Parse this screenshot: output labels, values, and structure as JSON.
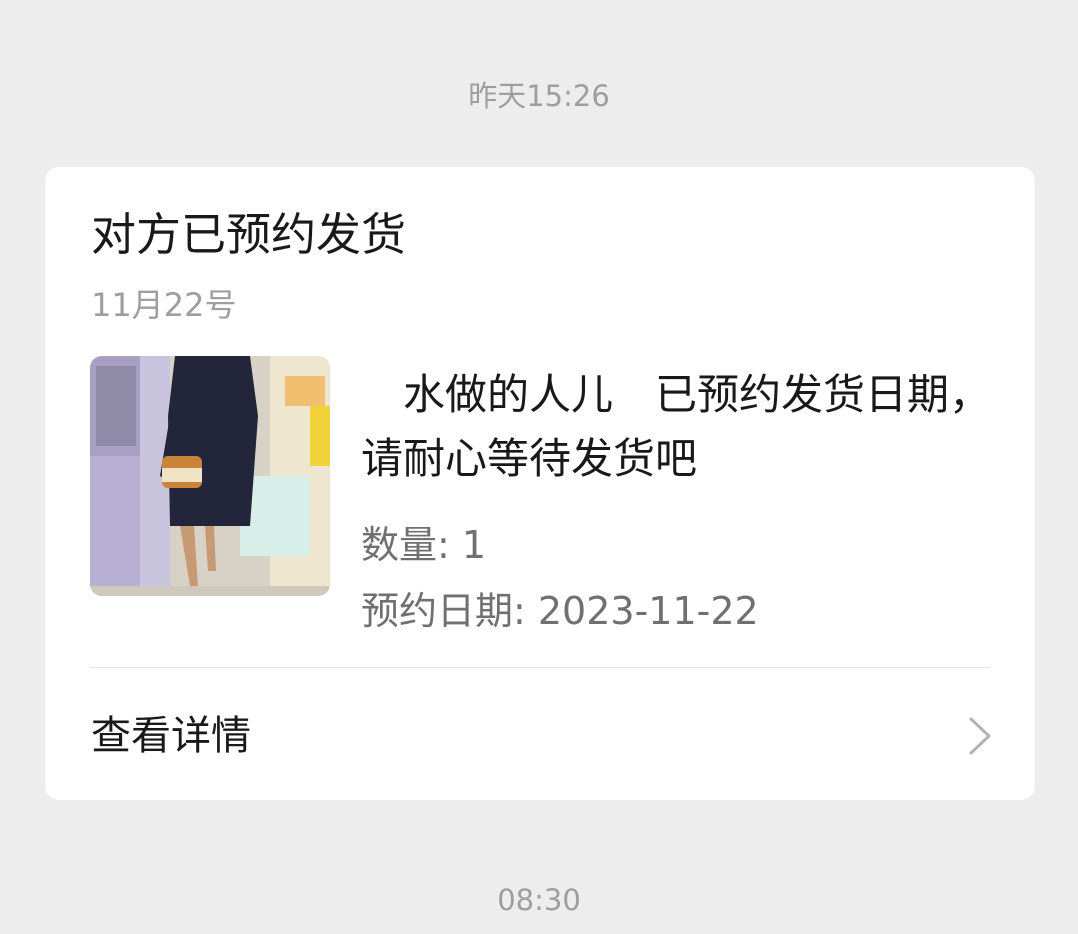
{
  "timestamps": {
    "top": "昨天15:26",
    "bottom": "08:30"
  },
  "card": {
    "title": "对方已预约发货",
    "date": "11月22号",
    "product": {
      "image_alt": "product-photo",
      "description": "　水做的人儿　已预约发货日期，请耐心等待发货吧"
    },
    "quantity_label": "数量: 1",
    "reserve_date_label": "预约日期: 2023-11-22",
    "details_link": "查看详情",
    "details_icon": "chevron-right-icon"
  },
  "colors": {
    "background": "#ededed",
    "card": "#ffffff",
    "primary_text": "#191919",
    "secondary_text": "#9e9e9e",
    "info_text": "#707070"
  }
}
